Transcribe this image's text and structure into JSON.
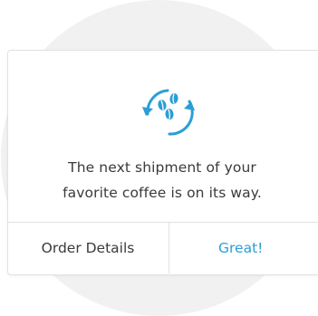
{
  "message": {
    "line1": "The next shipment of your",
    "line2": "favorite coffee is on its way."
  },
  "actions": {
    "order_details_label": "Order Details",
    "confirm_label": "Great!"
  },
  "icon": {
    "name": "coffee-beans-refresh-icon",
    "color": "#2a9fd6"
  },
  "colors": {
    "accent": "#2a9fd6",
    "text": "#3a3a3a",
    "background_circle": "#f1f1f1",
    "border": "#e2e2e2"
  }
}
